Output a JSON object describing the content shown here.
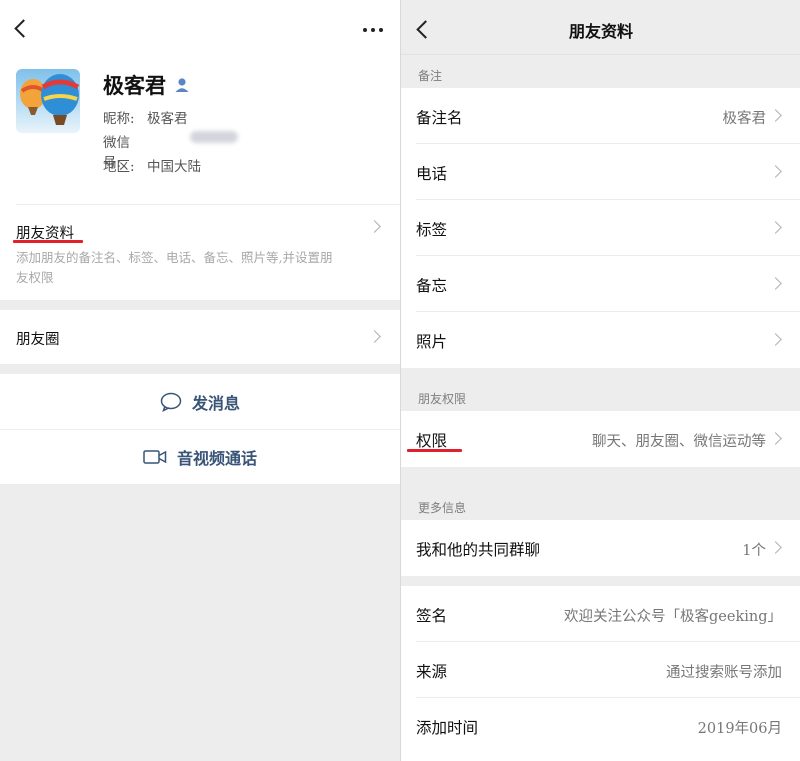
{
  "left": {
    "profile": {
      "name": "极客君",
      "nickname_label": "昵称:",
      "nickname": "极客君",
      "wechat_id_label": "微信号:",
      "region_label": "地区:",
      "region": "中国大陆"
    },
    "friend_info": {
      "title": "朋友资料",
      "subtitle_line1": "添加朋友的备注名、标签、电话、备忘、照片等,并设置朋",
      "subtitle_line2": "友权限"
    },
    "moments": {
      "title": "朋友圈"
    },
    "send_message": "发消息",
    "video_call": "音视频通话"
  },
  "right": {
    "title": "朋友资料",
    "sections": {
      "remark": "备注",
      "permissions": "朋友权限",
      "more": "更多信息"
    },
    "rows": {
      "remark_name_label": "备注名",
      "remark_name_value": "极客君",
      "phone_label": "电话",
      "tags_label": "标签",
      "memo_label": "备忘",
      "photos_label": "照片",
      "permission_label": "权限",
      "permission_value": "聊天、朋友圈、微信运动等",
      "groups_label": "我和他的共同群聊",
      "groups_value": "1个",
      "signature_label": "签名",
      "signature_value": "欢迎关注公众号「极客geeking」",
      "source_label": "来源",
      "source_value": "通过搜索账号添加",
      "added_label": "添加时间",
      "added_value": "2019年06月"
    }
  },
  "colors": {
    "accent_red": "#e0202c",
    "action_blue": "#3a5477",
    "verified_blue": "#5a86c4"
  },
  "icons": [
    "back-icon",
    "more-icon",
    "person-icon",
    "chevron-right-icon",
    "message-bubble-icon",
    "video-camera-icon"
  ]
}
